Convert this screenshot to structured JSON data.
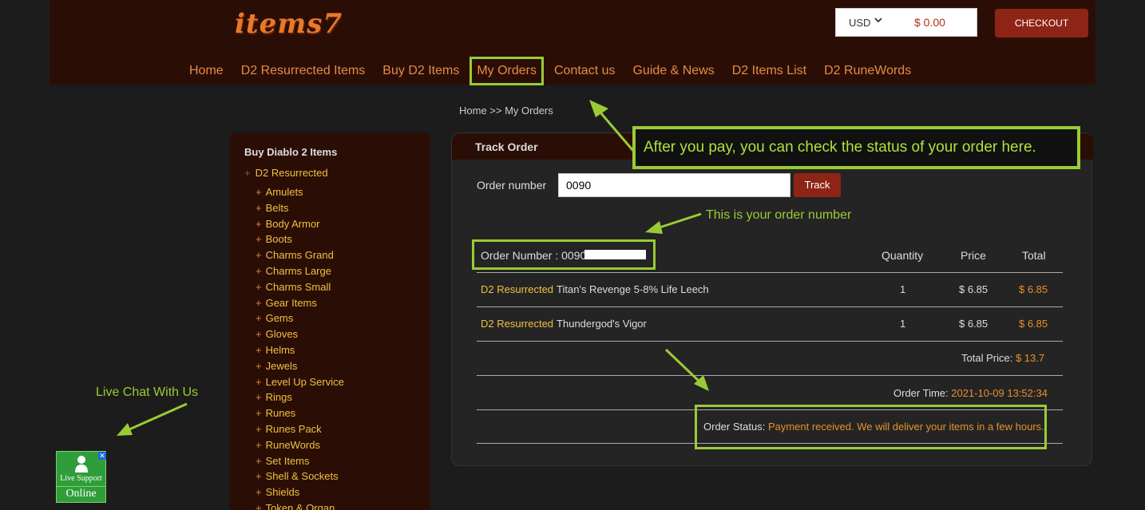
{
  "brand": {
    "logo": "items7"
  },
  "header": {
    "currency": "USD",
    "cart_total": "$ 0.00",
    "checkout_label": "CHECKOUT"
  },
  "nav": {
    "items": [
      "Home",
      "D2 Resurrected Items",
      "Buy D2 Items",
      "My Orders",
      "Contact us",
      "Guide & News",
      "D2 Items List",
      "D2 RuneWords"
    ],
    "active": "My Orders"
  },
  "breadcrumb": "Home >> My Orders",
  "sidebar": {
    "title": "Buy Diablo 2 Items",
    "category": "D2 Resurrected",
    "items": [
      "Amulets",
      "Belts",
      "Body Armor",
      "Boots",
      "Charms Grand",
      "Charms Large",
      "Charms Small",
      "Gear Items",
      "Gems",
      "Gloves",
      "Helms",
      "Jewels",
      "Level Up Service",
      "Rings",
      "Runes",
      "Runes Pack",
      "RuneWords",
      "Set Items",
      "Shell & Sockets",
      "Shields",
      "Token & Organ"
    ]
  },
  "track": {
    "panel_title": "Track Order",
    "order_label": "Order number",
    "order_value": "0090",
    "track_label": "Track"
  },
  "order": {
    "number_label": "Order Number : 0090",
    "columns": {
      "quantity": "Quantity",
      "price": "Price",
      "total": "Total"
    },
    "rows": [
      {
        "game": "D2 Resurrected",
        "item": "Titan's Revenge 5-8% Life Leech",
        "qty": "1",
        "price": "$ 6.85",
        "total": "$ 6.85"
      },
      {
        "game": "D2 Resurrected",
        "item": "Thundergod's Vigor",
        "qty": "1",
        "price": "$ 6.85",
        "total": "$ 6.85"
      }
    ],
    "total_label": "Total Price:",
    "total_value": "$ 13.7",
    "time_label": "Order Time:",
    "time_value": "2021-10-09 13:52:34",
    "status_label": "Order Status:",
    "status_value": "Payment received. We will deliver your items in a few hours."
  },
  "annotations": {
    "callout": "After you pay, you can check the status of your order here.",
    "order_number_note": "This is your order number",
    "live_chat_note": "Live Chat With Us",
    "accent": "#99cc33"
  },
  "chat": {
    "line1": "Live Support",
    "line2": "Online"
  }
}
